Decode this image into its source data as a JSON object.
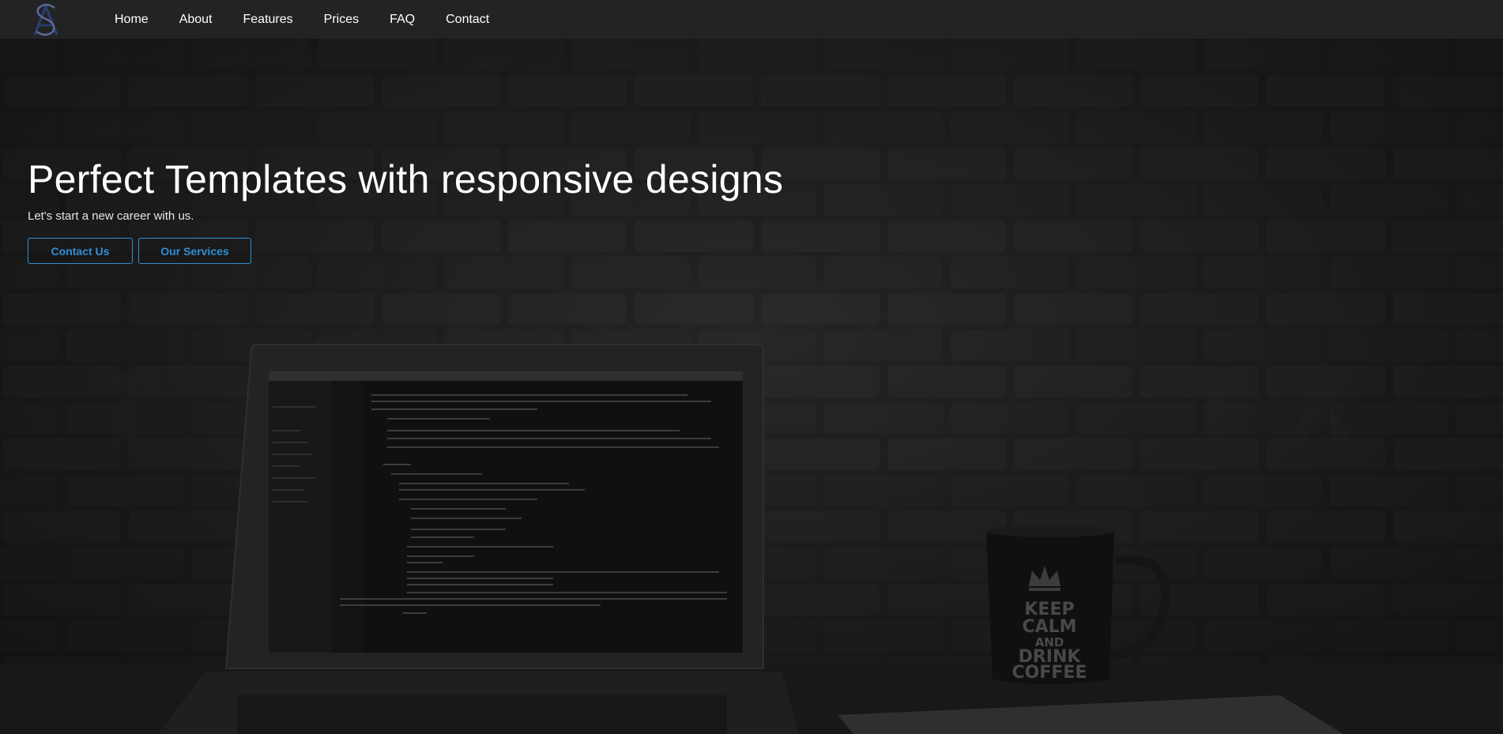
{
  "brand": {
    "logo_icon": "as-monogram-logo-icon",
    "accent": "#2e8fd6"
  },
  "nav": {
    "items": [
      {
        "label": "Home"
      },
      {
        "label": "About"
      },
      {
        "label": "Features"
      },
      {
        "label": "Prices"
      },
      {
        "label": "FAQ"
      },
      {
        "label": "Contact"
      }
    ]
  },
  "hero": {
    "title": "Perfect Templates with responsive designs",
    "subtitle": "Let's start a new career with us.",
    "buttons": {
      "contact_label": "Contact Us",
      "services_label": "Our Services"
    },
    "mug_text": [
      "KEEP",
      "CALM",
      "AND",
      "DRINK",
      "COFFEE"
    ]
  }
}
